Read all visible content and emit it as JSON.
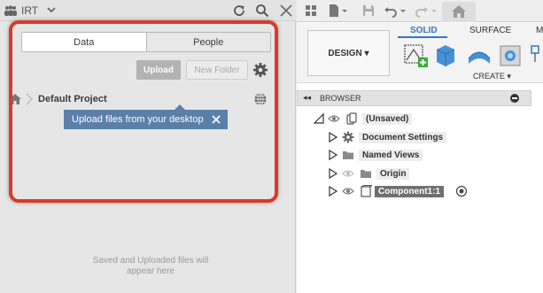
{
  "left_panel": {
    "team_name": "IRT",
    "tabs": [
      {
        "label": "Data"
      },
      {
        "label": "People"
      }
    ],
    "upload_label": "Upload",
    "new_folder_label": "New Folder",
    "breadcrumb_project": "Default Project",
    "tooltip_text": "Upload files from your desktop",
    "empty_message_line1": "Saved and Uploaded files will",
    "empty_message_line2": "appear here"
  },
  "right_panel": {
    "design_label": "DESIGN ▾",
    "workspace_tabs": {
      "solid": "SOLID",
      "surface": "SURFACE",
      "more": "M"
    },
    "create_label": "CREATE ▾",
    "browser_title": "BROWSER",
    "browser_arrows": "◂◂",
    "tree": {
      "root": "(Unsaved)",
      "document_settings": "Document Settings",
      "named_views": "Named Views",
      "origin": "Origin",
      "component": "Component1:1"
    }
  },
  "colors": {
    "accent_blue": "#2f79c2",
    "tooltip_blue": "#5b7fa8",
    "highlight_red": "#d93a2b"
  },
  "icons": [
    "team-icon",
    "refresh-icon",
    "search-icon",
    "close-icon",
    "grid-icon",
    "file-icon",
    "save-icon",
    "undo-icon",
    "redo-icon",
    "home-icon",
    "gear-icon",
    "globe-icon",
    "eye-icon",
    "folder-icon",
    "radio-icon"
  ]
}
